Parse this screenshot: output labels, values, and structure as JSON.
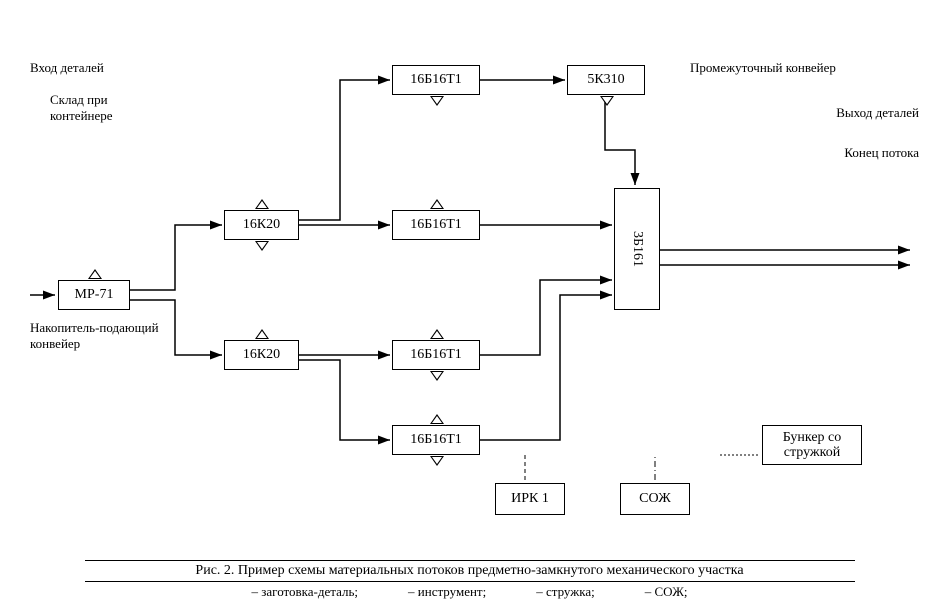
{
  "annotations": {
    "in_details": "Вход деталей",
    "warehouse": "Склад при контейнере",
    "incoming_conveyor": "Накопитель-подающий конвейер",
    "intermediate_conveyor": "Промежуточный конвейер",
    "out_details": "Выход деталей",
    "end_flow": "Конец потока"
  },
  "boxes": {
    "mp71": "МР-71",
    "k20_a": "16К20",
    "k20_b": "16К20",
    "b16_top": "16Б16Т1",
    "b16_mid": "16Б16Т1",
    "b16_mid2": "16Б16Т1",
    "b16_bot": "16Б16Т1",
    "k310": "5К310",
    "b161": "3Б161",
    "irk1": "ИРК 1",
    "sozh": "СОЖ",
    "bunker_l1": "Бункер со",
    "bunker_l2": "стружкой"
  },
  "caption": {
    "title": "Рис. 2. Пример схемы материальных потоков предметно-замкнутого механического участка",
    "legend": [
      "– заготовка-деталь;",
      "– инструмент;",
      "– стружка;",
      "– СОЖ;"
    ]
  }
}
